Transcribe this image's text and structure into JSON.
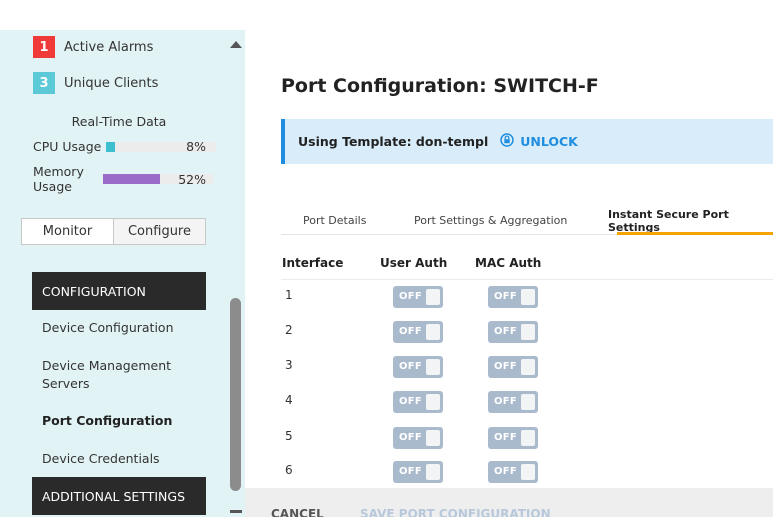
{
  "sidebar": {
    "alarms": {
      "count": "1",
      "label": "Active Alarms"
    },
    "clients": {
      "count": "3",
      "label": "Unique Clients"
    },
    "realtime_title": "Real-Time Data",
    "cpu": {
      "label": "CPU Usage",
      "value": "8%",
      "fraction": 0.08,
      "color": "#3dbfd0"
    },
    "memory": {
      "label": "Memory Usage",
      "value": "52%",
      "fraction": 0.52,
      "color": "#9b6bc9"
    },
    "mode_tabs": {
      "monitor": "Monitor",
      "configure": "Configure"
    },
    "sections": {
      "configuration": "CONFIGURATION",
      "additional": "ADDITIONAL SETTINGS"
    },
    "items": [
      {
        "label": "Device Configuration"
      },
      {
        "label": "Device Management Servers"
      },
      {
        "label": "Port Configuration",
        "active": true
      },
      {
        "label": "Device Credentials"
      }
    ]
  },
  "main": {
    "title": "Port Configuration: SWITCH-F",
    "banner": {
      "text": "Using Template: don-templ",
      "action": "UNLOCK",
      "icon": "lock-icon"
    },
    "tabs": [
      {
        "label": "Port Details"
      },
      {
        "label": "Port Settings & Aggregation"
      },
      {
        "label": "Instant Secure Port Settings",
        "active": true
      }
    ],
    "table": {
      "headers": [
        "Interface",
        "User Auth",
        "MAC Auth"
      ],
      "rows": [
        {
          "interface": "1",
          "user_auth": "OFF",
          "mac_auth": "OFF"
        },
        {
          "interface": "2",
          "user_auth": "OFF",
          "mac_auth": "OFF"
        },
        {
          "interface": "3",
          "user_auth": "OFF",
          "mac_auth": "OFF"
        },
        {
          "interface": "4",
          "user_auth": "OFF",
          "mac_auth": "OFF"
        },
        {
          "interface": "5",
          "user_auth": "OFF",
          "mac_auth": "OFF"
        },
        {
          "interface": "6",
          "user_auth": "OFF",
          "mac_auth": "OFF"
        }
      ]
    }
  },
  "footer": {
    "cancel": "CANCEL",
    "save": "SAVE PORT CONFIGURATION"
  }
}
